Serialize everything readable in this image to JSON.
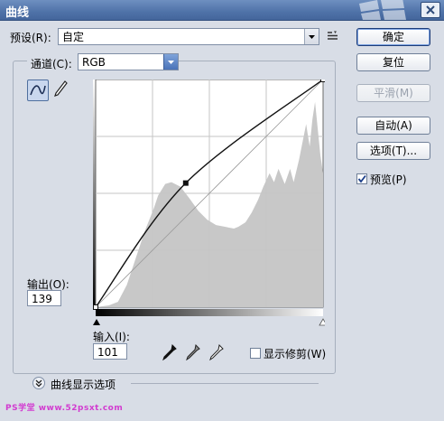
{
  "window": {
    "title": "曲线"
  },
  "preset": {
    "label": "预设(R):",
    "value": "自定"
  },
  "channel": {
    "label": "通道(C):",
    "value": "RGB"
  },
  "buttons": {
    "ok": "确定",
    "reset": "复位",
    "smooth": "平滑(M)",
    "auto": "自动(A)",
    "options": "选项(T)..."
  },
  "preview": {
    "label": "预览(P)",
    "checked": true
  },
  "output": {
    "label": "输出(O):",
    "value": "139"
  },
  "input": {
    "label": "输入(I):",
    "value": "101"
  },
  "show_clipping": {
    "label": "显示修剪(W)",
    "checked": false
  },
  "display_options": {
    "label": "曲线显示选项"
  },
  "watermark": {
    "text": "PS学堂 www.52psxt.com"
  },
  "curve": {
    "point": {
      "input": 101,
      "output": 139
    },
    "endpoint": {
      "input": 255,
      "output": 255
    }
  },
  "icons": {
    "close": "close-icon",
    "preset_menu": "list-menu-icon",
    "curve_tool": "curve-tool-icon",
    "pencil_tool": "pencil-icon",
    "eyedroppers": [
      "black-eyedropper-icon",
      "gray-eyedropper-icon",
      "white-eyedropper-icon"
    ],
    "expand": "chevron-double-down-icon"
  },
  "colors": {
    "titlebar": "#4f72a8",
    "dialog": "#d8dde6",
    "histogram": "#c4c4c4"
  }
}
